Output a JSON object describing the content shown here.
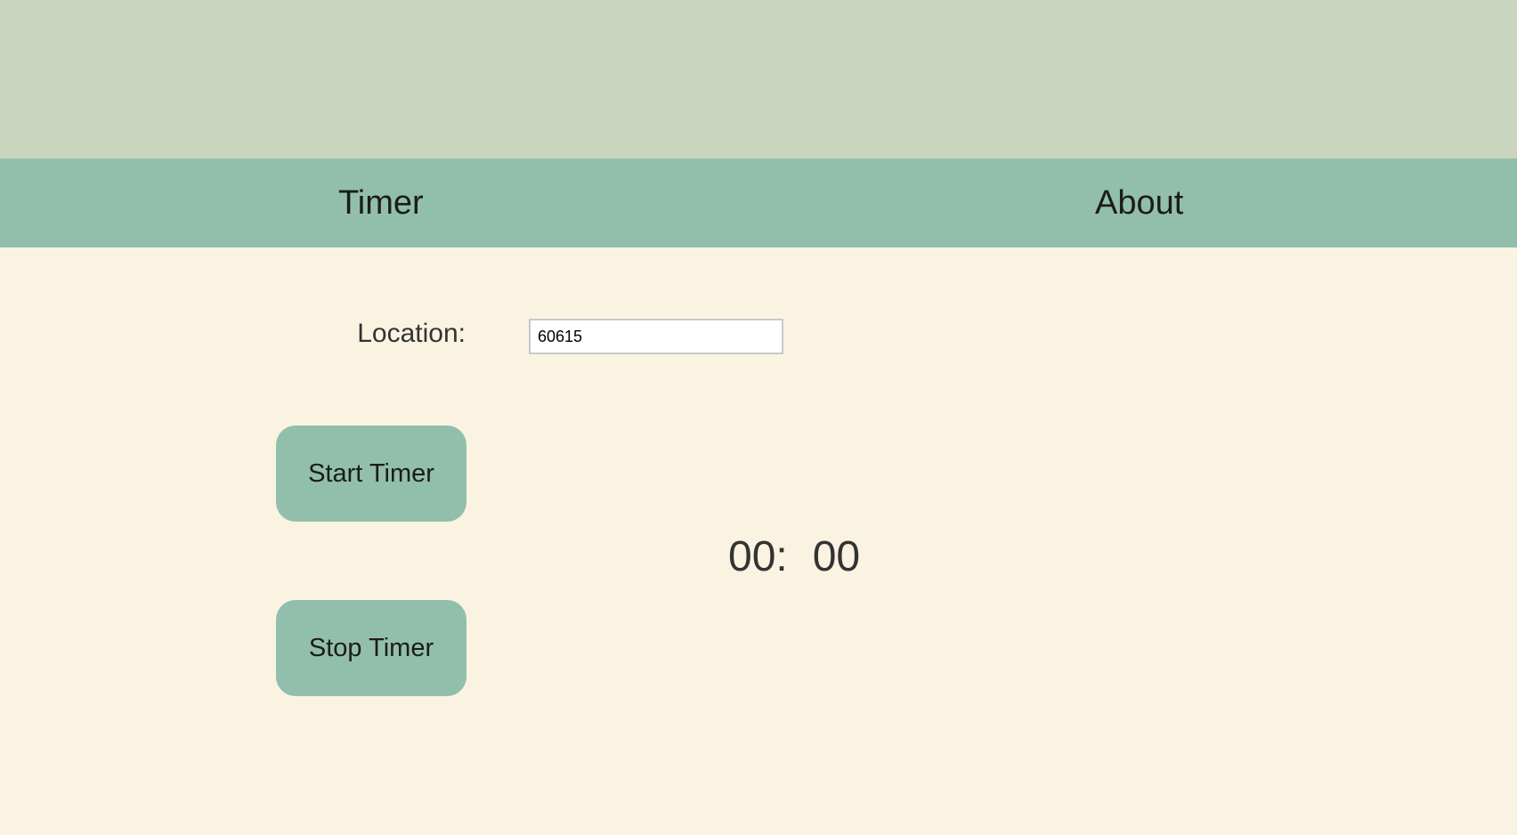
{
  "nav": {
    "timer_label": "Timer",
    "about_label": "About"
  },
  "location": {
    "label": "Location:",
    "value": "60615"
  },
  "buttons": {
    "start_label": "Start Timer",
    "stop_label": "Stop Timer"
  },
  "clock": {
    "minutes": "00",
    "separator": ":",
    "seconds": "00"
  },
  "colors": {
    "banner": "#cad5bd",
    "nav_background": "#92bfab",
    "page_background": "#faf3e1",
    "button_background": "#92bfab",
    "text_dark": "#333333"
  }
}
